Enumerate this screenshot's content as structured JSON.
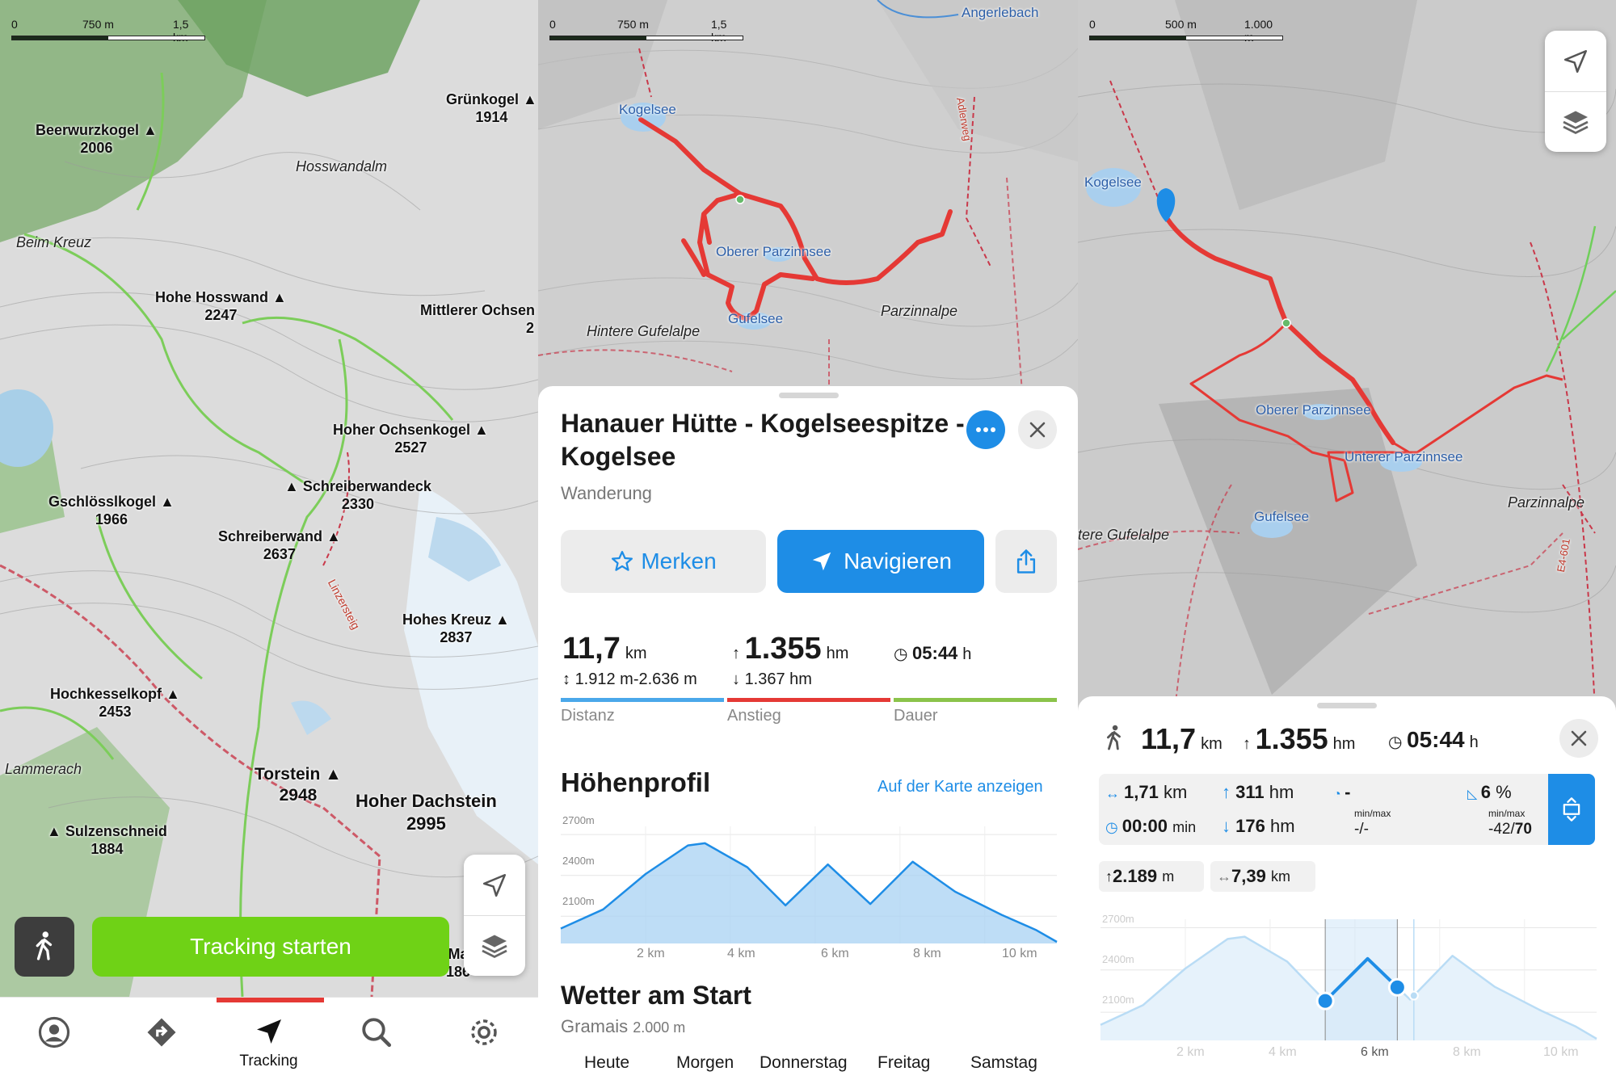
{
  "panel1": {
    "scale": {
      "zero": "0",
      "mid": "750 m",
      "end": "1,5 km"
    },
    "peaks": [
      {
        "name": "Beerwurzkogel",
        "elev": "2006"
      },
      {
        "name": "Grünkogel",
        "elev": "1914"
      },
      {
        "name": "Hohe Hosswand",
        "elev": "2247"
      },
      {
        "name": "Mittlerer Ochsen",
        "elev": "2"
      },
      {
        "name": "Hoher Ochsenkogel",
        "elev": "2527"
      },
      {
        "name": "Schreiberwandeck",
        "elev": "2330"
      },
      {
        "name": "Gschlösslkogel",
        "elev": "1966"
      },
      {
        "name": "Schreiberwand",
        "elev": "2637"
      },
      {
        "name": "Hohes Kreuz",
        "elev": "2837"
      },
      {
        "name": "Hochkesselkopf",
        "elev": "2453"
      },
      {
        "name": "Torstein",
        "elev": "2948"
      },
      {
        "name": "Hoher Dachstein",
        "elev": "2995"
      },
      {
        "name": "Sulzenschneid",
        "elev": "1884"
      },
      {
        "name": "Ma",
        "elev": "186"
      }
    ],
    "places": {
      "hosswandalm": "Hosswandalm",
      "beim_kreuz": "Beim Kreuz",
      "lammerach": "Lammerach",
      "linzersteig": "Linzersteig"
    },
    "tracking_button": "Tracking starten",
    "tabs": {
      "tracking": "Tracking"
    }
  },
  "panel2": {
    "scale": {
      "zero": "0",
      "mid": "750 m",
      "end": "1,5 km"
    },
    "labels": {
      "angerlebach": "Angerlebach",
      "kogelsee": "Kogelsee",
      "oberer": "Oberer Parzinnsee",
      "gufelsee": "Gufelsee",
      "hintere": "Hintere Gufelalpe",
      "parzinnalpe": "Parzinnalpe",
      "trail": "Adlerweg"
    },
    "title": "Hanauer Hütte - Kogelseespitze - Kogelsee",
    "subtitle": "Wanderung",
    "merken": "Merken",
    "navigieren": "Navigieren",
    "stats": {
      "distance": "11,7",
      "distance_unit": "km",
      "range": "1.912 m-2.636 m",
      "ascent": "1.355",
      "ascent_unit": "hm",
      "descent": "1.367 hm",
      "duration": "05:44",
      "duration_unit": "h"
    },
    "seg_labels": {
      "distanz": "Distanz",
      "anstieg": "Anstieg",
      "dauer": "Dauer"
    },
    "profile_title": "Höhenprofil",
    "profile_link": "Auf der Karte anzeigen",
    "yaxis": [
      "2700m",
      "2400m",
      "2100m"
    ],
    "xaxis": [
      "2 km",
      "4 km",
      "6 km",
      "8 km",
      "10 km"
    ],
    "weather_title": "Wetter am Start",
    "weather_place": "Gramais",
    "weather_elev": "2.000 m",
    "days": [
      "Heute",
      "Morgen",
      "Donnerstag",
      "Freitag",
      "Samstag"
    ]
  },
  "panel3": {
    "scale": {
      "zero": "0",
      "mid": "500 m",
      "end": "1.000 m"
    },
    "labels": {
      "kogelsee": "Kogelsee",
      "oberer": "Oberer Parzinnsee",
      "unterer": "Unterer Parzinnsee",
      "gufelsee": "Gufelsee",
      "hintere": "tere Gufelalpe",
      "parzinnalpe": "Parzinnalpe",
      "trail": "E4-601"
    },
    "stats": {
      "distance": "11,7",
      "distance_unit": "km",
      "ascent": "1.355",
      "ascent_unit": "hm",
      "duration": "05:44",
      "duration_unit": "h"
    },
    "section": {
      "dist": "1,71",
      "dist_unit": "km",
      "up": "311",
      "up_unit": "hm",
      "speed": "-",
      "speed_sub": "min/max",
      "speed_val": "-/-",
      "grade": "6",
      "grade_unit": "%",
      "grade_sub": "min/max",
      "grade_min": "-42/",
      "grade_max": "70",
      "time": "00:00",
      "time_unit": "min",
      "down": "176",
      "down_unit": "hm"
    },
    "chips": {
      "elev": "2.189",
      "elev_unit": "m",
      "dist": "7,39",
      "dist_unit": "km"
    },
    "yaxis": [
      "2700m",
      "2400m",
      "2100m"
    ],
    "xaxis": [
      "2 km",
      "4 km",
      "6 km",
      "8 km",
      "10 km"
    ]
  },
  "colors": {
    "accent_blue": "#1e8de6",
    "route_red": "#e53935",
    "tracking_green": "#6fd216",
    "profile_fill": "#cfe6f8",
    "segment_green": "#8bc34a"
  },
  "chart_data": [
    {
      "type": "area",
      "title": "Höhenprofil",
      "xlabel": "",
      "ylabel": "",
      "x": [
        0,
        1,
        2,
        3,
        3.4,
        4.4,
        5.3,
        6.3,
        7.3,
        8.3,
        9.3,
        10.4,
        11.2,
        11.7
      ],
      "y": [
        2010,
        2150,
        2410,
        2620,
        2636,
        2460,
        2180,
        2480,
        2190,
        2500,
        2280,
        2110,
        2000,
        1912
      ],
      "xticks": [
        "2 km",
        "4 km",
        "6 km",
        "8 km",
        "10 km"
      ],
      "yticks": [
        "2100m",
        "2400m",
        "2700m"
      ],
      "ylim": [
        1900,
        2760
      ]
    },
    {
      "type": "area",
      "title": "",
      "x": [
        0,
        1,
        2,
        3,
        3.4,
        4.4,
        5.3,
        6.3,
        7.3,
        8.3,
        9.3,
        10.4,
        11.2,
        11.7
      ],
      "y": [
        2010,
        2150,
        2410,
        2620,
        2636,
        2460,
        2180,
        2480,
        2190,
        2500,
        2280,
        2110,
        2000,
        1912
      ],
      "selection_km": [
        5.3,
        7.0
      ],
      "xticks": [
        "2 km",
        "4 km",
        "6 km",
        "8 km",
        "10 km"
      ],
      "yticks": [
        "2100m",
        "2400m",
        "2700m"
      ],
      "ylim": [
        1900,
        2760
      ]
    }
  ]
}
